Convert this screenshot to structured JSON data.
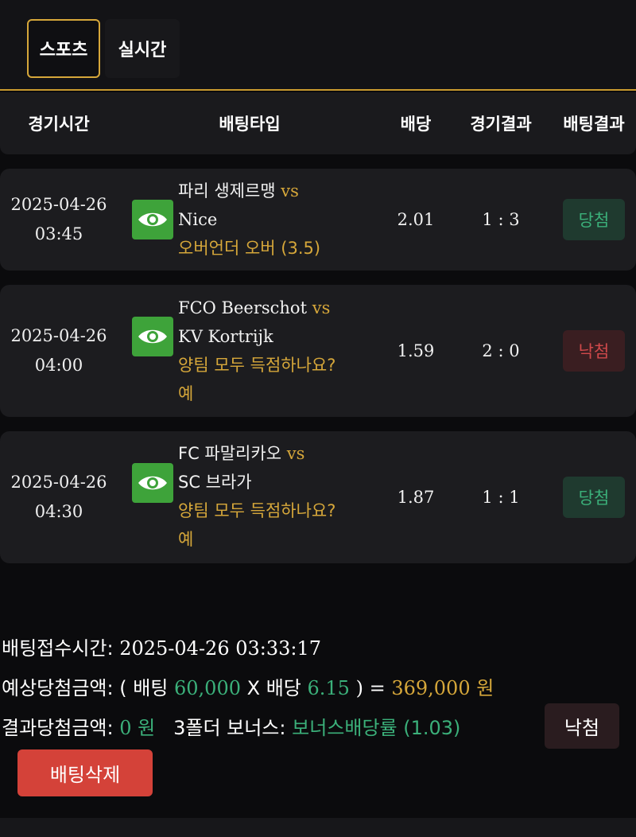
{
  "tabs": [
    {
      "label": "스포츠",
      "active": true
    },
    {
      "label": "실시간",
      "active": false
    }
  ],
  "table": {
    "headers": {
      "time": "경기시간",
      "bet_type": "배팅타입",
      "odds": "배당",
      "game_result": "경기결과",
      "bet_result": "배팅결과"
    },
    "rows": [
      {
        "date": "2025-04-26",
        "time": "03:45",
        "home": "파리 생제르맹",
        "vs": "vs",
        "away": "Nice",
        "pick_lines": [
          "오버언더 오버 (3.5)"
        ],
        "odds": "2.01",
        "score": "1 : 3",
        "result": "당첨",
        "result_type": "win"
      },
      {
        "date": "2025-04-26",
        "time": "04:00",
        "home": "FCO Beerschot",
        "vs": "vs",
        "away": "KV Kortrijk",
        "pick_lines": [
          "양팀 모두 득점하나요?",
          "예"
        ],
        "odds": "1.59",
        "score": "2 : 0",
        "result": "낙첨",
        "result_type": "lose"
      },
      {
        "date": "2025-04-26",
        "time": "04:30",
        "home": "FC 파말리카오",
        "vs": "vs",
        "away": "SC 브라가",
        "pick_lines": [
          "양팀 모두 득점하나요?",
          "예"
        ],
        "odds": "1.87",
        "score": "1 : 1",
        "result": "당첨",
        "result_type": "win"
      }
    ]
  },
  "summary": {
    "accept_time_label": "배팅접수시간:",
    "accept_time_value": "2025-04-26 03:33:17",
    "expected_label": "예상당첨금액:",
    "expected_open": "( 배팅",
    "bet_amount": "60,000",
    "times": "X 배당",
    "total_odds": "6.15",
    "close_eq": ") =",
    "expected_amount": "369,000 원",
    "result_label": "결과당첨금액:",
    "result_amount": "0 원",
    "bonus_label": "3폴더 보너스:",
    "bonus_value": "보너스배당률 (1.03)",
    "result_status": "낙첨",
    "delete_label": "배팅삭제"
  },
  "colors": {
    "accent_gold": "#d6a73a",
    "win_green": "#3bb07a",
    "lose_red": "#d0494b",
    "eye_button_green": "#3ea33a",
    "delete_red": "#d44239"
  }
}
